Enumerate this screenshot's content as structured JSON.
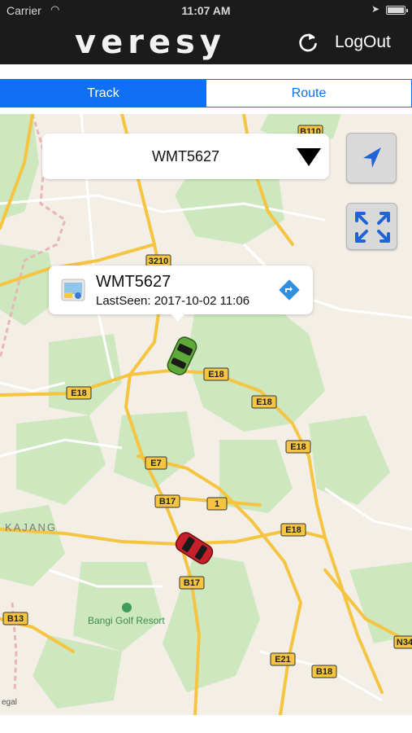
{
  "status_bar": {
    "carrier": "Carrier",
    "time": "11:07 AM"
  },
  "header": {
    "brand": "veresy",
    "logout_label": "LogOut",
    "refresh_icon": "refresh-icon",
    "background": "#1b1b1b"
  },
  "tabs": [
    {
      "label": "Track",
      "active": true
    },
    {
      "label": "Route",
      "active": false
    }
  ],
  "accent_color": "#0f6ff5",
  "vehicle_select": {
    "selected": "WMT5627"
  },
  "callout": {
    "title": "WMT5627",
    "last_seen": "LastSeen: 2017-10-02 11:06"
  },
  "map": {
    "road_labels": [
      "3210",
      "B110",
      "E18",
      "E18",
      "E18",
      "E18",
      "E18",
      "E7",
      "B17",
      "1",
      "E18",
      "B17",
      "B13",
      "E21",
      "B18",
      "N34"
    ],
    "place_labels": [
      "KAJANG",
      "Bangi Golf Resort"
    ],
    "legal": "egal",
    "vehicles": [
      {
        "color": "green",
        "icon": "green-car-icon"
      },
      {
        "color": "red",
        "icon": "red-car-icon"
      }
    ]
  }
}
